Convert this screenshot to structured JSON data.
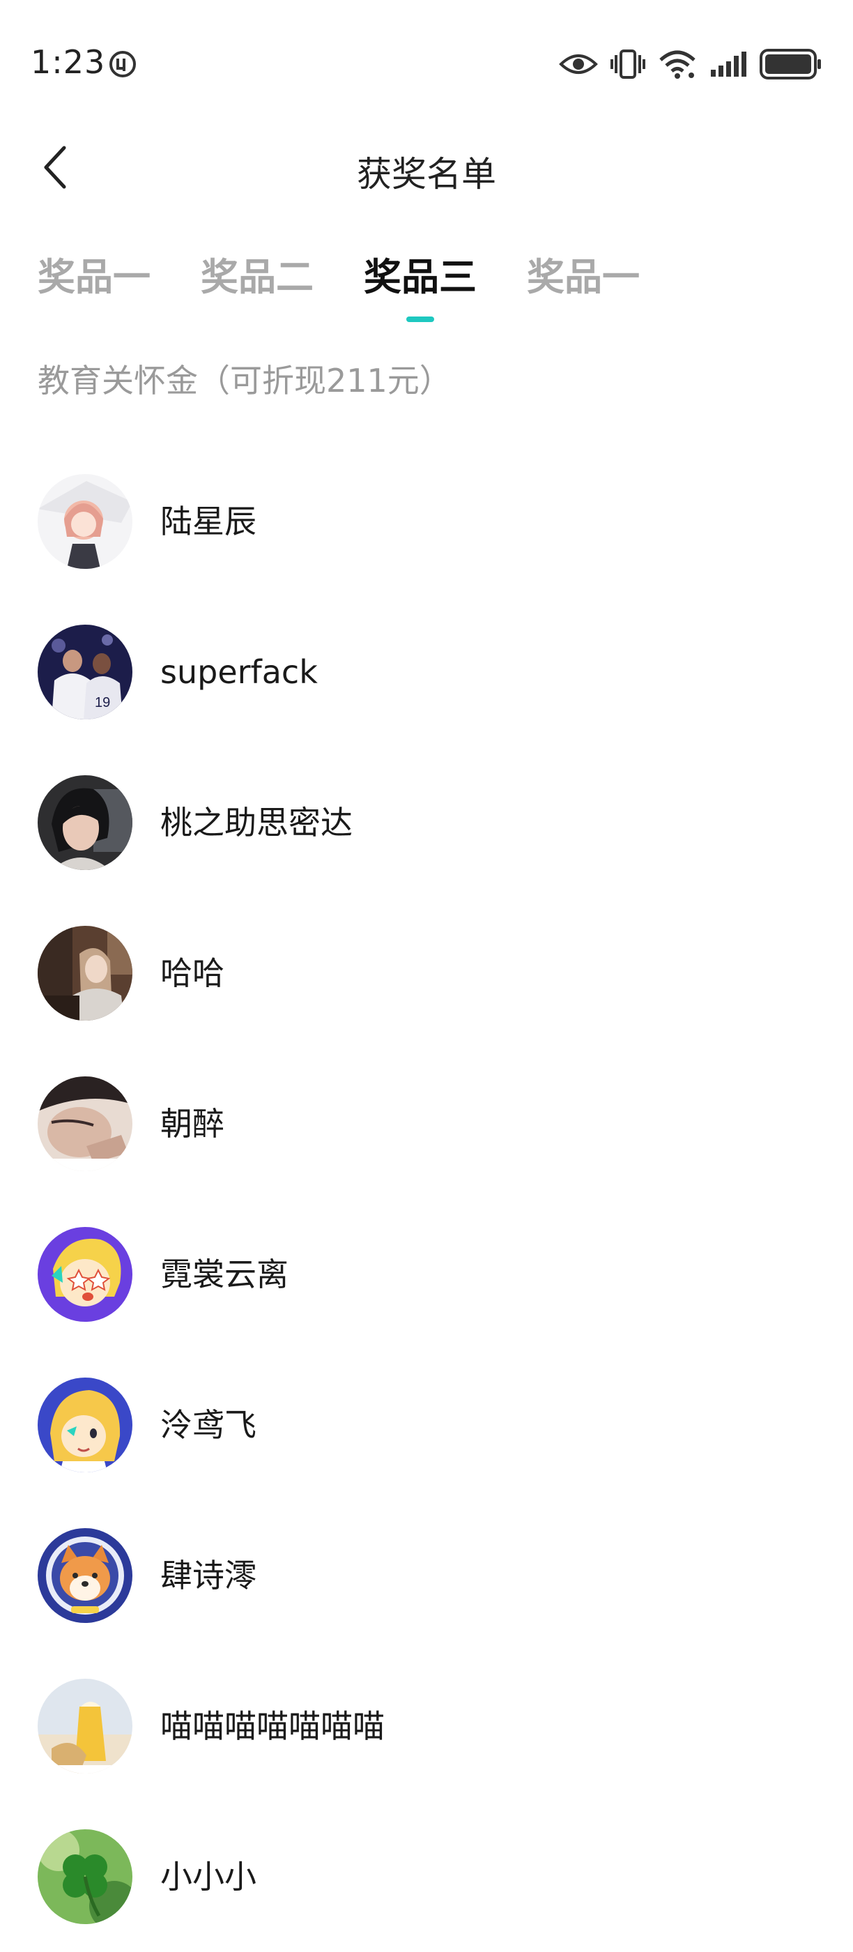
{
  "status_bar": {
    "time": "1:23",
    "icons": [
      "app-notification-icon",
      "eye-icon",
      "vibrate-icon",
      "wifi-icon",
      "signal-icon",
      "battery-icon"
    ]
  },
  "header": {
    "title": "获奖名单",
    "back_icon": "chevron-left-icon"
  },
  "tabs": [
    {
      "label": "奖品一",
      "active": false
    },
    {
      "label": "奖品二",
      "active": false
    },
    {
      "label": "奖品三",
      "active": true
    },
    {
      "label": "奖品一",
      "active": false
    }
  ],
  "accent_color": "#1ec8c0",
  "section": {
    "subtitle": "教育关怀金（可折现211元）"
  },
  "winners": [
    {
      "name": "陆星辰",
      "avatar": "anime-girl-avatar"
    },
    {
      "name": "superfack",
      "avatar": "soccer-players-avatar"
    },
    {
      "name": "桃之助思密达",
      "avatar": "woman-selfie-avatar"
    },
    {
      "name": "哈哈",
      "avatar": "woman-portrait-avatar"
    },
    {
      "name": "朝醉",
      "avatar": "person-closeup-avatar"
    },
    {
      "name": "霓裳云离",
      "avatar": "cartoon-star-eyes-avatar"
    },
    {
      "name": "泠鸢飞",
      "avatar": "cartoon-blonde-avatar"
    },
    {
      "name": "肆诗澪",
      "avatar": "shiba-dog-avatar"
    },
    {
      "name": "喵喵喵喵喵喵喵",
      "avatar": "drink-photo-avatar"
    },
    {
      "name": "小小小",
      "avatar": "clover-avatar"
    }
  ]
}
